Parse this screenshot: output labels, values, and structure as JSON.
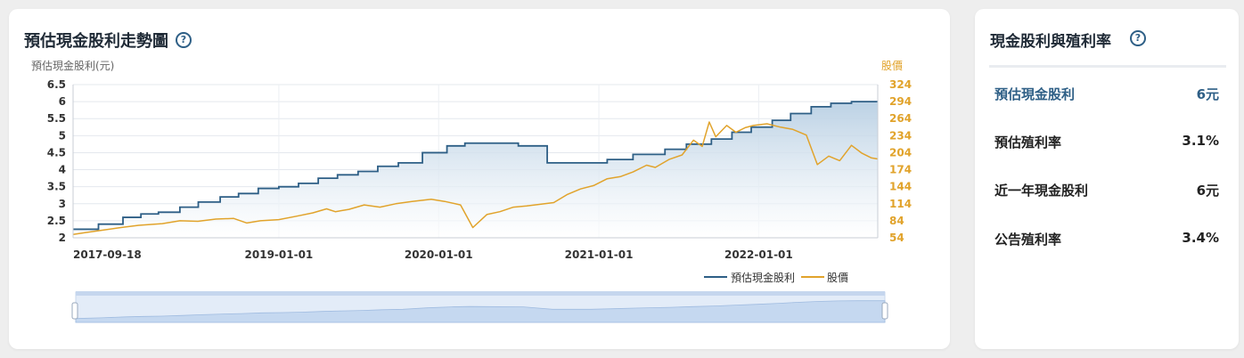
{
  "chart_card": {
    "title": "預估現金股利走勢圖",
    "help_symbol": "?"
  },
  "stats_card": {
    "title": "現金股利與殖利率",
    "help_symbol": "?",
    "rows": [
      {
        "label": "預估現金股利",
        "value": "6元"
      },
      {
        "label": "預估殖利率",
        "value": "3.1%"
      },
      {
        "label": "近一年現金股利",
        "value": "6元"
      },
      {
        "label": "公告殖利率",
        "value": "3.4%"
      }
    ]
  },
  "colors": {
    "dividend_line": "#2e5f86",
    "price_line": "#e1a32b",
    "area_fill_top": "#b8cfe3",
    "accent": "#2e5f86"
  },
  "chart_data": {
    "type": "line",
    "left_axis_label": "預估現金股利(元)",
    "right_axis_label": "股價",
    "x_ticks": [
      "2017-09-18",
      "2019-01-01",
      "2020-01-01",
      "2021-01-01",
      "2022-01-01"
    ],
    "x_range": [
      "2017-09-18",
      "2022-09-30"
    ],
    "y_left_ticks": [
      "2",
      "2.5",
      "3",
      "3.5",
      "4",
      "4.5",
      "5",
      "5.5",
      "6",
      "6.5"
    ],
    "y_left_range": [
      2,
      6.5
    ],
    "y_right_ticks": [
      "54",
      "84",
      "114",
      "144",
      "174",
      "204",
      "234",
      "264",
      "294",
      "324"
    ],
    "y_right_range": [
      54,
      324
    ],
    "grid": true,
    "legend_position": "bottom-right",
    "series": [
      {
        "name": "預估現金股利",
        "axis": "left",
        "style": "step-area",
        "points": [
          [
            "2017-09-18",
            2.25
          ],
          [
            "2017-11-15",
            2.4
          ],
          [
            "2018-01-10",
            2.6
          ],
          [
            "2018-02-20",
            2.7
          ],
          [
            "2018-04-01",
            2.75
          ],
          [
            "2018-05-20",
            2.9
          ],
          [
            "2018-07-01",
            3.05
          ],
          [
            "2018-08-20",
            3.2
          ],
          [
            "2018-10-01",
            3.3
          ],
          [
            "2018-11-15",
            3.45
          ],
          [
            "2019-01-01",
            3.5
          ],
          [
            "2019-02-15",
            3.6
          ],
          [
            "2019-04-01",
            3.75
          ],
          [
            "2019-05-15",
            3.85
          ],
          [
            "2019-07-01",
            3.95
          ],
          [
            "2019-08-15",
            4.1
          ],
          [
            "2019-10-01",
            4.2
          ],
          [
            "2019-11-25",
            4.5
          ],
          [
            "2020-01-20",
            4.7
          ],
          [
            "2020-03-01",
            4.78
          ],
          [
            "2020-07-01",
            4.7
          ],
          [
            "2020-09-05",
            4.2
          ],
          [
            "2020-12-01",
            4.2
          ],
          [
            "2021-01-20",
            4.3
          ],
          [
            "2021-03-20",
            4.45
          ],
          [
            "2021-06-01",
            4.6
          ],
          [
            "2021-07-20",
            4.75
          ],
          [
            "2021-09-15",
            4.9
          ],
          [
            "2021-11-01",
            5.1
          ],
          [
            "2021-12-15",
            5.25
          ],
          [
            "2022-02-01",
            5.45
          ],
          [
            "2022-03-15",
            5.65
          ],
          [
            "2022-05-01",
            5.85
          ],
          [
            "2022-06-15",
            5.95
          ],
          [
            "2022-08-01",
            6.0
          ],
          [
            "2022-09-30",
            6.0
          ]
        ]
      },
      {
        "name": "股價",
        "axis": "right",
        "style": "line",
        "points": [
          [
            "2017-09-18",
            60
          ],
          [
            "2017-10-15",
            63
          ],
          [
            "2017-11-20",
            67
          ],
          [
            "2018-01-05",
            72
          ],
          [
            "2018-02-15",
            76
          ],
          [
            "2018-04-10",
            79
          ],
          [
            "2018-05-20",
            84
          ],
          [
            "2018-06-30",
            83
          ],
          [
            "2018-08-10",
            87
          ],
          [
            "2018-09-20",
            88
          ],
          [
            "2018-10-20",
            80
          ],
          [
            "2018-11-20",
            84
          ],
          [
            "2019-01-01",
            86
          ],
          [
            "2019-02-10",
            92
          ],
          [
            "2019-03-20",
            98
          ],
          [
            "2019-04-20",
            105
          ],
          [
            "2019-05-10",
            100
          ],
          [
            "2019-06-10",
            104
          ],
          [
            "2019-07-15",
            112
          ],
          [
            "2019-08-20",
            108
          ],
          [
            "2019-09-25",
            114
          ],
          [
            "2019-11-01",
            118
          ],
          [
            "2019-12-15",
            122
          ],
          [
            "2020-01-15",
            118
          ],
          [
            "2020-02-20",
            112
          ],
          [
            "2020-03-19",
            72
          ],
          [
            "2020-04-20",
            95
          ],
          [
            "2020-05-20",
            100
          ],
          [
            "2020-06-20",
            108
          ],
          [
            "2020-07-20",
            110
          ],
          [
            "2020-08-20",
            113
          ],
          [
            "2020-09-20",
            116
          ],
          [
            "2020-10-20",
            130
          ],
          [
            "2020-11-20",
            140
          ],
          [
            "2020-12-20",
            146
          ],
          [
            "2021-01-20",
            158
          ],
          [
            "2021-02-20",
            162
          ],
          [
            "2021-03-20",
            170
          ],
          [
            "2021-04-20",
            182
          ],
          [
            "2021-05-10",
            178
          ],
          [
            "2021-06-10",
            192
          ],
          [
            "2021-07-10",
            200
          ],
          [
            "2021-08-05",
            226
          ],
          [
            "2021-08-25",
            215
          ],
          [
            "2021-09-10",
            258
          ],
          [
            "2021-09-25",
            232
          ],
          [
            "2021-10-20",
            252
          ],
          [
            "2021-11-10",
            240
          ],
          [
            "2021-12-01",
            248
          ],
          [
            "2021-12-20",
            252
          ],
          [
            "2022-01-20",
            255
          ],
          [
            "2022-02-20",
            249
          ],
          [
            "2022-03-20",
            245
          ],
          [
            "2022-04-20",
            235
          ],
          [
            "2022-05-15",
            183
          ],
          [
            "2022-06-10",
            198
          ],
          [
            "2022-07-05",
            190
          ],
          [
            "2022-08-01",
            217
          ],
          [
            "2022-08-25",
            203
          ],
          [
            "2022-09-15",
            195
          ],
          [
            "2022-09-30",
            193
          ]
        ]
      }
    ]
  }
}
